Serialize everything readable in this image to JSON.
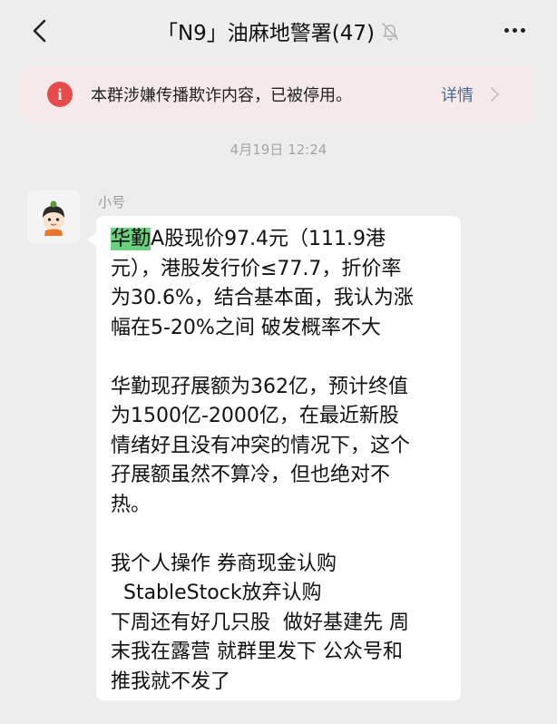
{
  "header": {
    "back_icon": "chevron-left-icon",
    "title": "「N9」油麻地警署(47)",
    "mute_icon": "bell-off-icon",
    "more_icon": "more-dots-icon"
  },
  "notice": {
    "icon": "exclamation-icon",
    "text": "本群涉嫌传播欺诈内容，已被停用。",
    "detail_label": "详情",
    "chevron_icon": "chevron-right-icon",
    "colors": {
      "background": "#f5e9ea",
      "icon": "#e84b4b",
      "link": "#4a6b96"
    }
  },
  "chat": {
    "timestamp": "4月19日 12:24",
    "message": {
      "sender": "小号",
      "avatar_icon": "cartoon-avatar",
      "highlight_word": "华勤",
      "highlight_color": "#6bd07f",
      "first_line_rest": "A股现价97.4元（111.9港",
      "lines": [
        "元），港股发行价≤77.7，折价率",
        "为30.6%，结合基本面，我认为涨",
        "幅在5-20%之间 破发概率不大",
        "",
        "华勤现孖展额为362亿，预计终值",
        "为1500亿-2000亿，在最近新股",
        "情绪好且没有冲突的情况下，这个",
        "孖展额虽然不算冷，但也绝对不",
        "热。",
        "",
        "我个人操作 券商现金认购",
        "  StableStock放弃认购",
        "下周还有好几只股  做好基建先 周",
        "末我在露营 就群里发下 公众号和",
        "推我就不发了"
      ]
    }
  }
}
